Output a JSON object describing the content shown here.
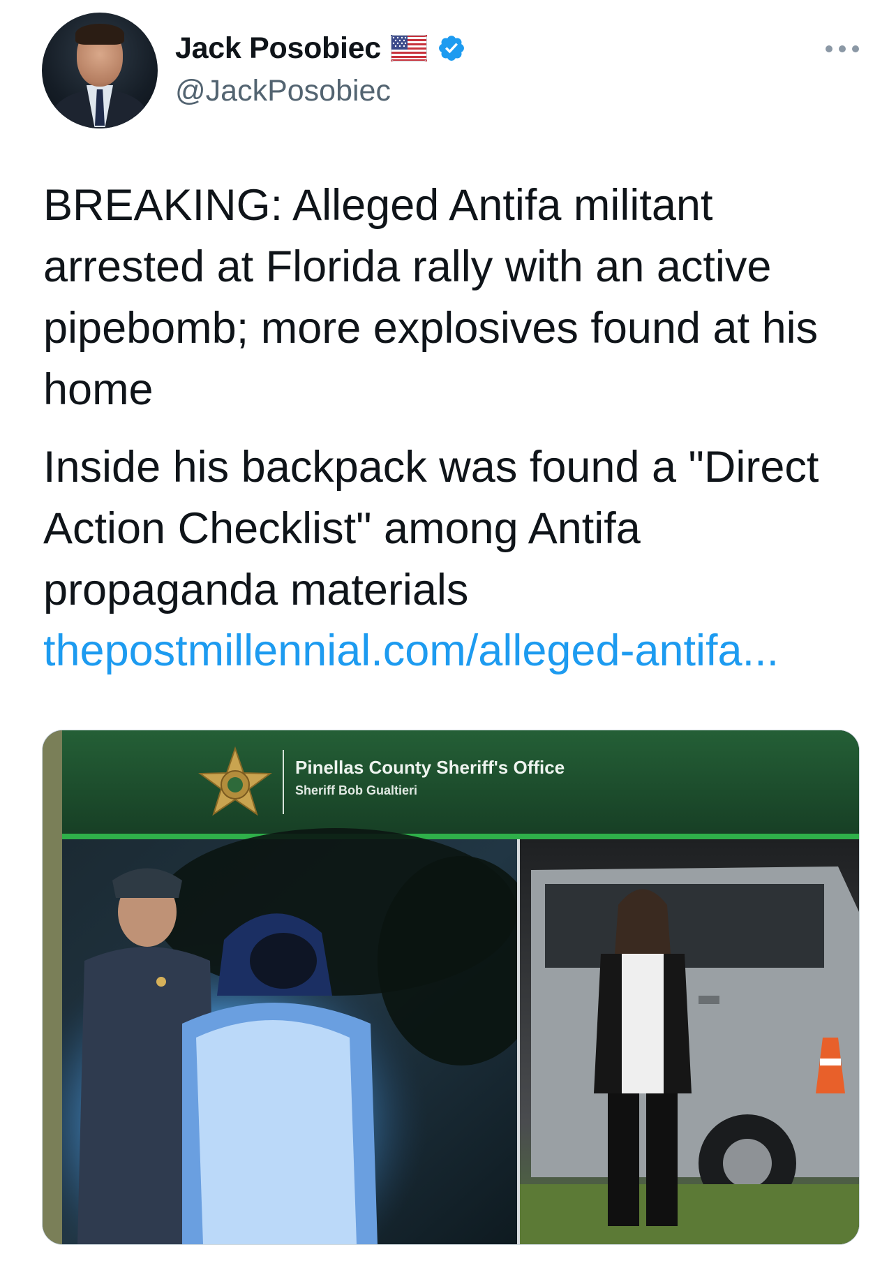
{
  "author": {
    "name": "Jack Posobiec",
    "handle": "@JackPosobiec",
    "flag_icon": "us-flag-icon",
    "verified_icon": "verified-badge-icon"
  },
  "tweet": {
    "paragraph1": "BREAKING: Alleged Antifa militant arrested at Florida rally with an active pipebomb; more explosives found at his home",
    "paragraph2": "Inside his backpack was found a \"Direct Action Checklist\" among Antifa propaganda materials",
    "link": "thepostmillennial.com/alleged-antifa..."
  },
  "media": {
    "banner_title": "Pinellas County Sheriff's Office",
    "banner_subtitle": "Sheriff Bob Gualtieri"
  },
  "colors": {
    "link": "#1d9bf0",
    "verified": "#1d9bf0",
    "banner_green": "#1f5a32",
    "accent_green": "#2fb04a"
  }
}
